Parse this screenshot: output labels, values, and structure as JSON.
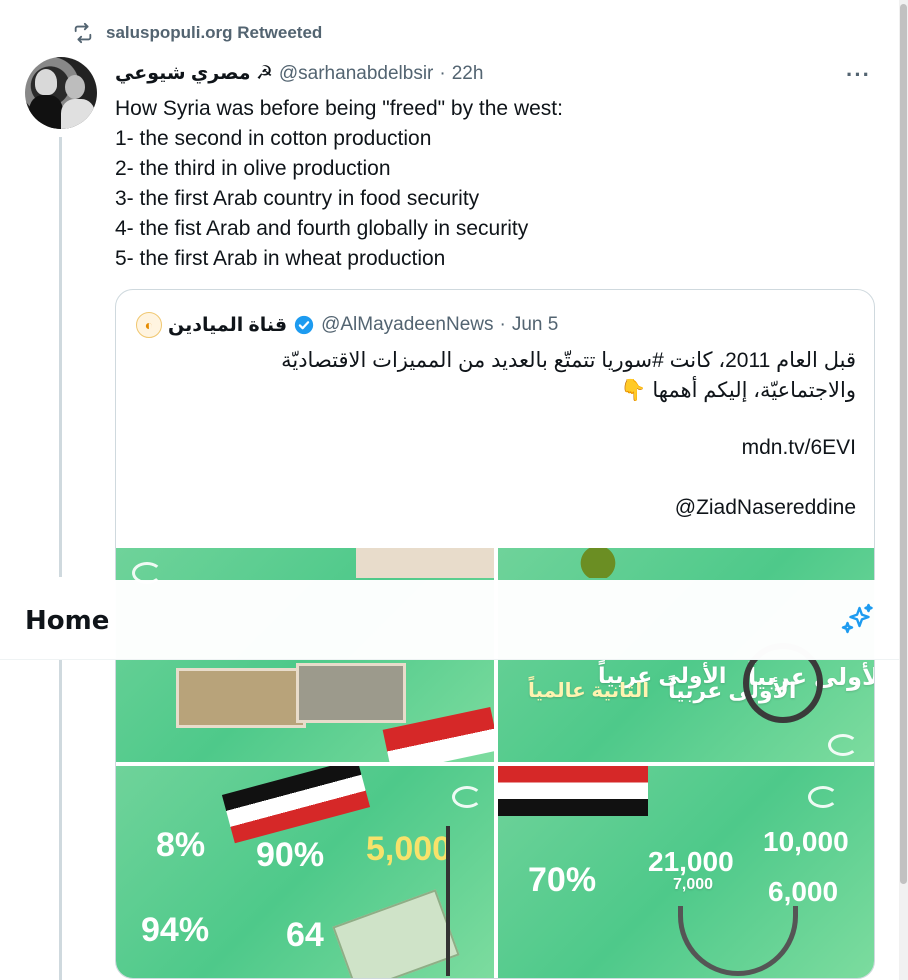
{
  "retweet": {
    "text": "saluspopuli.org Retweeted",
    "icon": "retweet-icon"
  },
  "tweet": {
    "author_name": "مصري شيوعي ☭",
    "handle": "@sarhanabdelbsir",
    "separator": "·",
    "time": "22h",
    "more": "···",
    "lines": [
      "How Syria was before being \"freed\" by the west:",
      "1- the second in cotton production",
      "2- the third in olive production",
      "3- the first Arab country in food security",
      "4- the fist Arab and fourth globally in security",
      "5- the first Arab in wheat production"
    ]
  },
  "quote": {
    "name": "قناة الميادين",
    "handle": "@AlMayadeenNews",
    "separator": "·",
    "date": "Jun 5",
    "text_line1": "قبل العام 2011، كانت #سوريا تتمتّع بالعديد من المميزات الاقتصاديّة",
    "text_line2": "والاجتماعيّة، إليكم أهمها 👇",
    "link": "mdn.tv/6EVI",
    "mention": "@ZiadNasereddine",
    "images": {
      "t2_labels": [
        "الثانية عالمياً",
        "الأولى عربياً",
        "الأولى عربياً",
        "الأولى عربياً"
      ],
      "t3_stats": [
        "8%",
        "90%",
        "5,000",
        "94%",
        "64"
      ],
      "t4_stats": [
        "10,000",
        "21,000",
        "70%",
        "6,000",
        "7,000"
      ]
    }
  },
  "home": {
    "title": "Home",
    "icon": "sparkle-icon"
  },
  "colors": {
    "accent": "#1d9bf0",
    "muted": "#536471",
    "tile_green": "#4ec98a"
  }
}
